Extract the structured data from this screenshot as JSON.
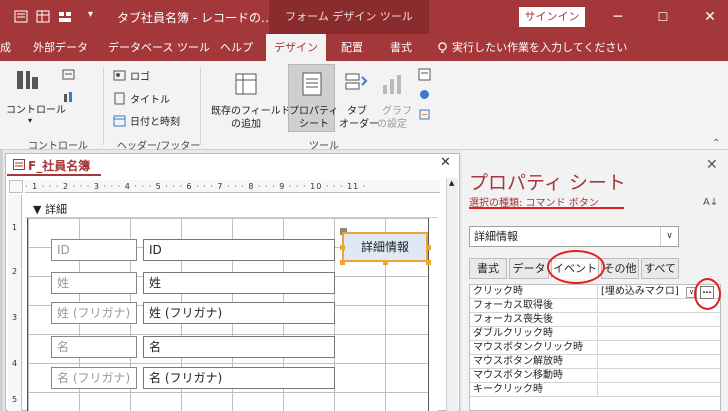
{
  "titlebar": {
    "doc_title": "タブ社員名簿 - レコードの…",
    "context_tab": "フォーム デザイン ツール",
    "signin": "サインイン",
    "quick_access_icons": [
      "form-icon",
      "datasheet-icon",
      "layout-icon",
      "customize-dropdown-icon"
    ]
  },
  "window_controls": {
    "minimize": "─",
    "restore": "☐",
    "close": "✕"
  },
  "tabs": {
    "create_partial": "成",
    "external_data": "外部データ",
    "database_tools": "データベース ツール",
    "help": "ヘルプ",
    "design": "デザイン",
    "arrange": "配置",
    "format": "書式",
    "tell_me": "実行したい作業を入力してください"
  },
  "ribbon": {
    "controls_label": "コントロール",
    "controls_group": "コントロール",
    "header_footer_group": "ヘッダー/フッター",
    "logo": "ロゴ",
    "title": "タイトル",
    "date_time": "日付と時刻",
    "add_existing_fields": [
      "既存のフィールド",
      "の追加"
    ],
    "property_sheet": [
      "プロパティ",
      "シート"
    ],
    "tab_order": [
      "タブ",
      "オーダー"
    ],
    "chart_settings": [
      "グラフ",
      "の設定"
    ],
    "tools_group": "ツール"
  },
  "form": {
    "tab_label": "F_社員名簿",
    "ruler_text": "· 1 · · · 2 · · · 3 · · · 4 · · · 5 · · · 6 · · · 7 · · · 8 · · · 9 · · · 10 · · · 11 ·",
    "ruler_v": [
      "1",
      "2",
      "3",
      "4",
      "5"
    ],
    "section": "詳細",
    "fields": [
      {
        "label": "ID",
        "value": "ID"
      },
      {
        "label": "姓",
        "value": "姓"
      },
      {
        "label": "姓 (フリガナ)",
        "value": "姓 (フリガナ)"
      },
      {
        "label": "名",
        "value": "名"
      },
      {
        "label": "名 (フリガナ)",
        "value": "名 (フリガナ)"
      }
    ],
    "command_button": "詳細情報"
  },
  "property_sheet": {
    "title": "プロパティ シート",
    "selection_type": "選択の種類: コマンド ボタン",
    "object_name": "詳細情報",
    "tabs": [
      "書式",
      "データ",
      "イベント",
      "その他",
      "すべて"
    ],
    "active_tab": "イベント",
    "rows": [
      {
        "name": "クリック時",
        "value": "[埋め込みマクロ]"
      },
      {
        "name": "フォーカス取得後",
        "value": ""
      },
      {
        "name": "フォーカス喪失後",
        "value": ""
      },
      {
        "name": "ダブルクリック時",
        "value": ""
      },
      {
        "name": "マウスボタンクリック時",
        "value": ""
      },
      {
        "name": "マウスボタン解放時",
        "value": ""
      },
      {
        "name": "マウスボタン移動時",
        "value": ""
      },
      {
        "name": "キークリック時",
        "value": ""
      }
    ],
    "builder_button": "…"
  },
  "colors": {
    "brand": "#a4373a",
    "context_tab": "#8a2b2e",
    "selection": "#f0a434",
    "annotation": "#e02020"
  }
}
